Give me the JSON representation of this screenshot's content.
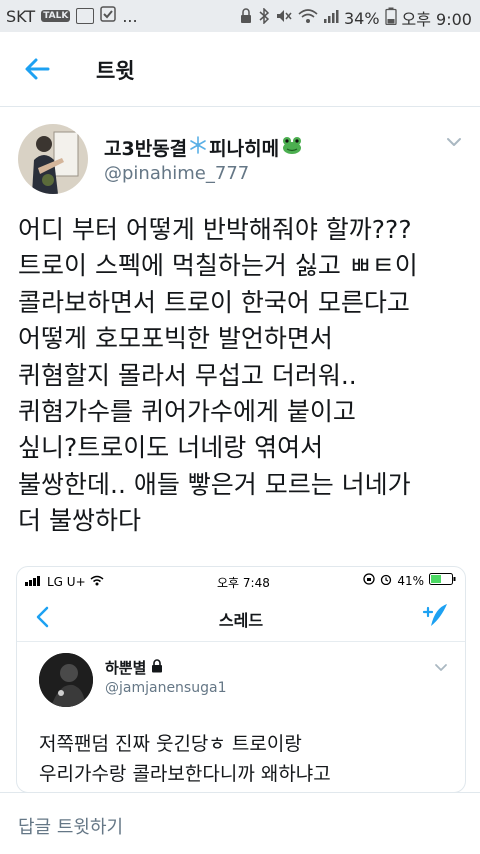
{
  "status_bar": {
    "carrier": "SKT",
    "talk_badge": "TALK",
    "dots": "...",
    "battery": "34%",
    "time": "오후 9:00"
  },
  "header": {
    "title": "트윗"
  },
  "tweet": {
    "author_name": "고3반동결",
    "author_suffix": "피나히메",
    "handle": "@pinahime_777",
    "text": "어디 부터 어떻게 반박해줘야 할까???\n트로이 스펙에 먹칠하는거 싫고 ㅃㅌ이\n콜라보하면서 트로이 한국어 모른다고\n어떻게 호모포빅한 발언하면서\n퀴혐할지 몰라서 무섭고 더러워..\n퀴혐가수를 퀴어가수에게 붙이고\n싶니?트로이도 너네랑 엮여서\n불쌍한데.. 애들 빻은거 모르는 너네가\n더 불쌍하다"
  },
  "embedded": {
    "status": {
      "carrier": "LG U+",
      "time": "오후 7:48",
      "battery": "41%"
    },
    "title": "스레드",
    "author_name": "하뿐별",
    "handle": "@jamjanensuga1",
    "text": "저쪽팬덤 진짜 웃긴당ㅎ 트로이랑\n우리가수랑 콜라보한다니까 왜하냐고"
  },
  "reply_bar": {
    "placeholder": "답글 트윗하기"
  },
  "colors": {
    "accent": "#1da1f2",
    "secondary_text": "#657786",
    "primary_text": "#14171a",
    "status_bar_bg": "#e9ecef"
  }
}
